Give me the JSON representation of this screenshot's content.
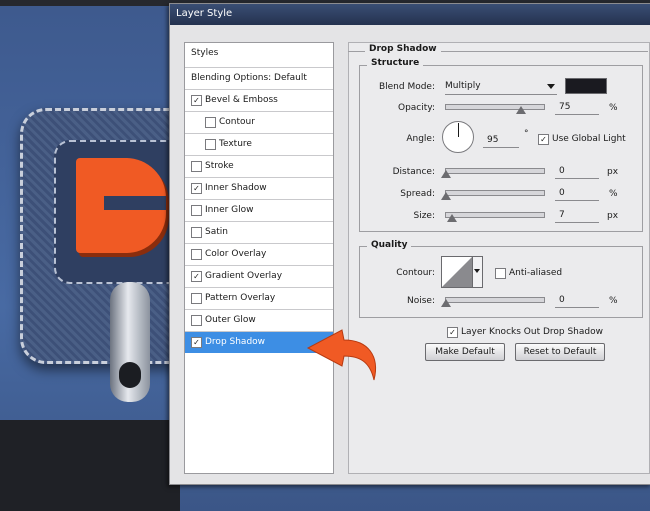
{
  "dialog": {
    "title": "Layer Style"
  },
  "styles_list": [
    {
      "label": "Styles",
      "has_checkbox": false,
      "checked": false,
      "indent": false,
      "selected": false
    },
    {
      "label": "Blending Options: Default",
      "has_checkbox": false,
      "checked": false,
      "indent": false,
      "selected": false
    },
    {
      "label": "Bevel & Emboss",
      "has_checkbox": true,
      "checked": true,
      "indent": false,
      "selected": false
    },
    {
      "label": "Contour",
      "has_checkbox": true,
      "checked": false,
      "indent": true,
      "selected": false
    },
    {
      "label": "Texture",
      "has_checkbox": true,
      "checked": false,
      "indent": true,
      "selected": false
    },
    {
      "label": "Stroke",
      "has_checkbox": true,
      "checked": false,
      "indent": false,
      "selected": false
    },
    {
      "label": "Inner Shadow",
      "has_checkbox": true,
      "checked": true,
      "indent": false,
      "selected": false
    },
    {
      "label": "Inner Glow",
      "has_checkbox": true,
      "checked": false,
      "indent": false,
      "selected": false
    },
    {
      "label": "Satin",
      "has_checkbox": true,
      "checked": false,
      "indent": false,
      "selected": false
    },
    {
      "label": "Color Overlay",
      "has_checkbox": true,
      "checked": false,
      "indent": false,
      "selected": false
    },
    {
      "label": "Gradient Overlay",
      "has_checkbox": true,
      "checked": true,
      "indent": false,
      "selected": false
    },
    {
      "label": "Pattern Overlay",
      "has_checkbox": true,
      "checked": false,
      "indent": false,
      "selected": false
    },
    {
      "label": "Outer Glow",
      "has_checkbox": true,
      "checked": false,
      "indent": false,
      "selected": false
    },
    {
      "label": "Drop Shadow",
      "has_checkbox": true,
      "checked": true,
      "indent": false,
      "selected": true
    }
  ],
  "drop_shadow": {
    "title": "Drop Shadow",
    "structure": {
      "title": "Structure",
      "blend_mode_label": "Blend Mode:",
      "blend_mode_value": "Multiply",
      "shadow_color": "#1a1a20",
      "opacity_label": "Opacity:",
      "opacity_value": "75",
      "opacity_unit": "%",
      "angle_label": "Angle:",
      "angle_value": "95",
      "angle_unit": "°",
      "use_global_light_label": "Use Global Light",
      "use_global_light_checked": true,
      "distance_label": "Distance:",
      "distance_value": "0",
      "distance_unit": "px",
      "spread_label": "Spread:",
      "spread_value": "0",
      "spread_unit": "%",
      "size_label": "Size:",
      "size_value": "7",
      "size_unit": "px"
    },
    "quality": {
      "title": "Quality",
      "contour_label": "Contour:",
      "anti_aliased_label": "Anti-aliased",
      "anti_aliased_checked": false,
      "noise_label": "Noise:",
      "noise_value": "0",
      "noise_unit": "%"
    },
    "knocks_out_label": "Layer Knocks Out Drop Shadow",
    "knocks_out_checked": true,
    "make_default_label": "Make Default",
    "reset_default_label": "Reset to Default"
  },
  "colors": {
    "accent": "#3d8ee4",
    "arrow": "#f05a24",
    "artwork_bg": "#486aa3"
  }
}
